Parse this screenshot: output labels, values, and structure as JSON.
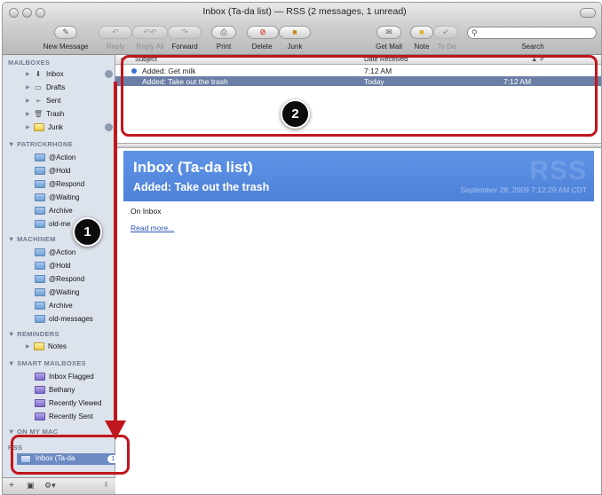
{
  "window": {
    "title": "Inbox (Ta-da list) — RSS (2 messages, 1 unread)"
  },
  "toolbar": {
    "new_message": "New Message",
    "reply": "Reply",
    "reply_all": "Reply All",
    "forward": "Forward",
    "print": "Print",
    "delete": "Delete",
    "junk": "Junk",
    "get_mail": "Get Mail",
    "note": "Note",
    "todo": "To Do",
    "search_label": "Search",
    "search_value": ""
  },
  "sidebar": {
    "mailboxes_header": "MAILBOXES",
    "mailboxes": [
      "Inbox",
      "Drafts",
      "Sent",
      "Trash",
      "Junk"
    ],
    "account1_header": "PATRICKRHONE",
    "account1_folders": [
      "@Action",
      "@Hold",
      "@Respond",
      "@Waiting",
      "Archive",
      "old-me"
    ],
    "account2_header": "MACHINEM",
    "account2_folders": [
      "@Action",
      "@Hold",
      "@Respond",
      "@Waiting",
      "Archive",
      "old-messages"
    ],
    "reminders_header": "REMINDERS",
    "reminders": [
      "Notes"
    ],
    "smart_header": "SMART MAILBOXES",
    "smart": [
      "Inbox Flagged",
      "Bethany",
      "Recently Viewed",
      "Recently Sent"
    ],
    "onmymac_header": "ON MY MAC",
    "rss_header": "RSS",
    "rss_item": "Inbox (Ta-da",
    "rss_count": "1"
  },
  "list": {
    "columns": {
      "subject": "Subject",
      "date": "Date Received"
    },
    "rows": [
      {
        "subject": "Added: Get milk",
        "date": "7:12 AM",
        "time": "",
        "unread": true,
        "selected": false
      },
      {
        "subject": "Added: Take out the trash",
        "date": "Today",
        "time": "7:12 AM",
        "unread": false,
        "selected": true
      }
    ]
  },
  "preview": {
    "feed_title": "Inbox (Ta-da list)",
    "item_title": "Added: Take out the trash",
    "watermark": "RSS",
    "date": "September 28, 2009 7:12:29 AM CDT",
    "body": "On Inbox",
    "read_more": "Read more..."
  },
  "annotations": {
    "callout1": "1",
    "callout2": "2"
  },
  "colors": {
    "highlight": "#c0161d",
    "banner": "#5b8fe3",
    "selection": "#6b7fa6"
  }
}
